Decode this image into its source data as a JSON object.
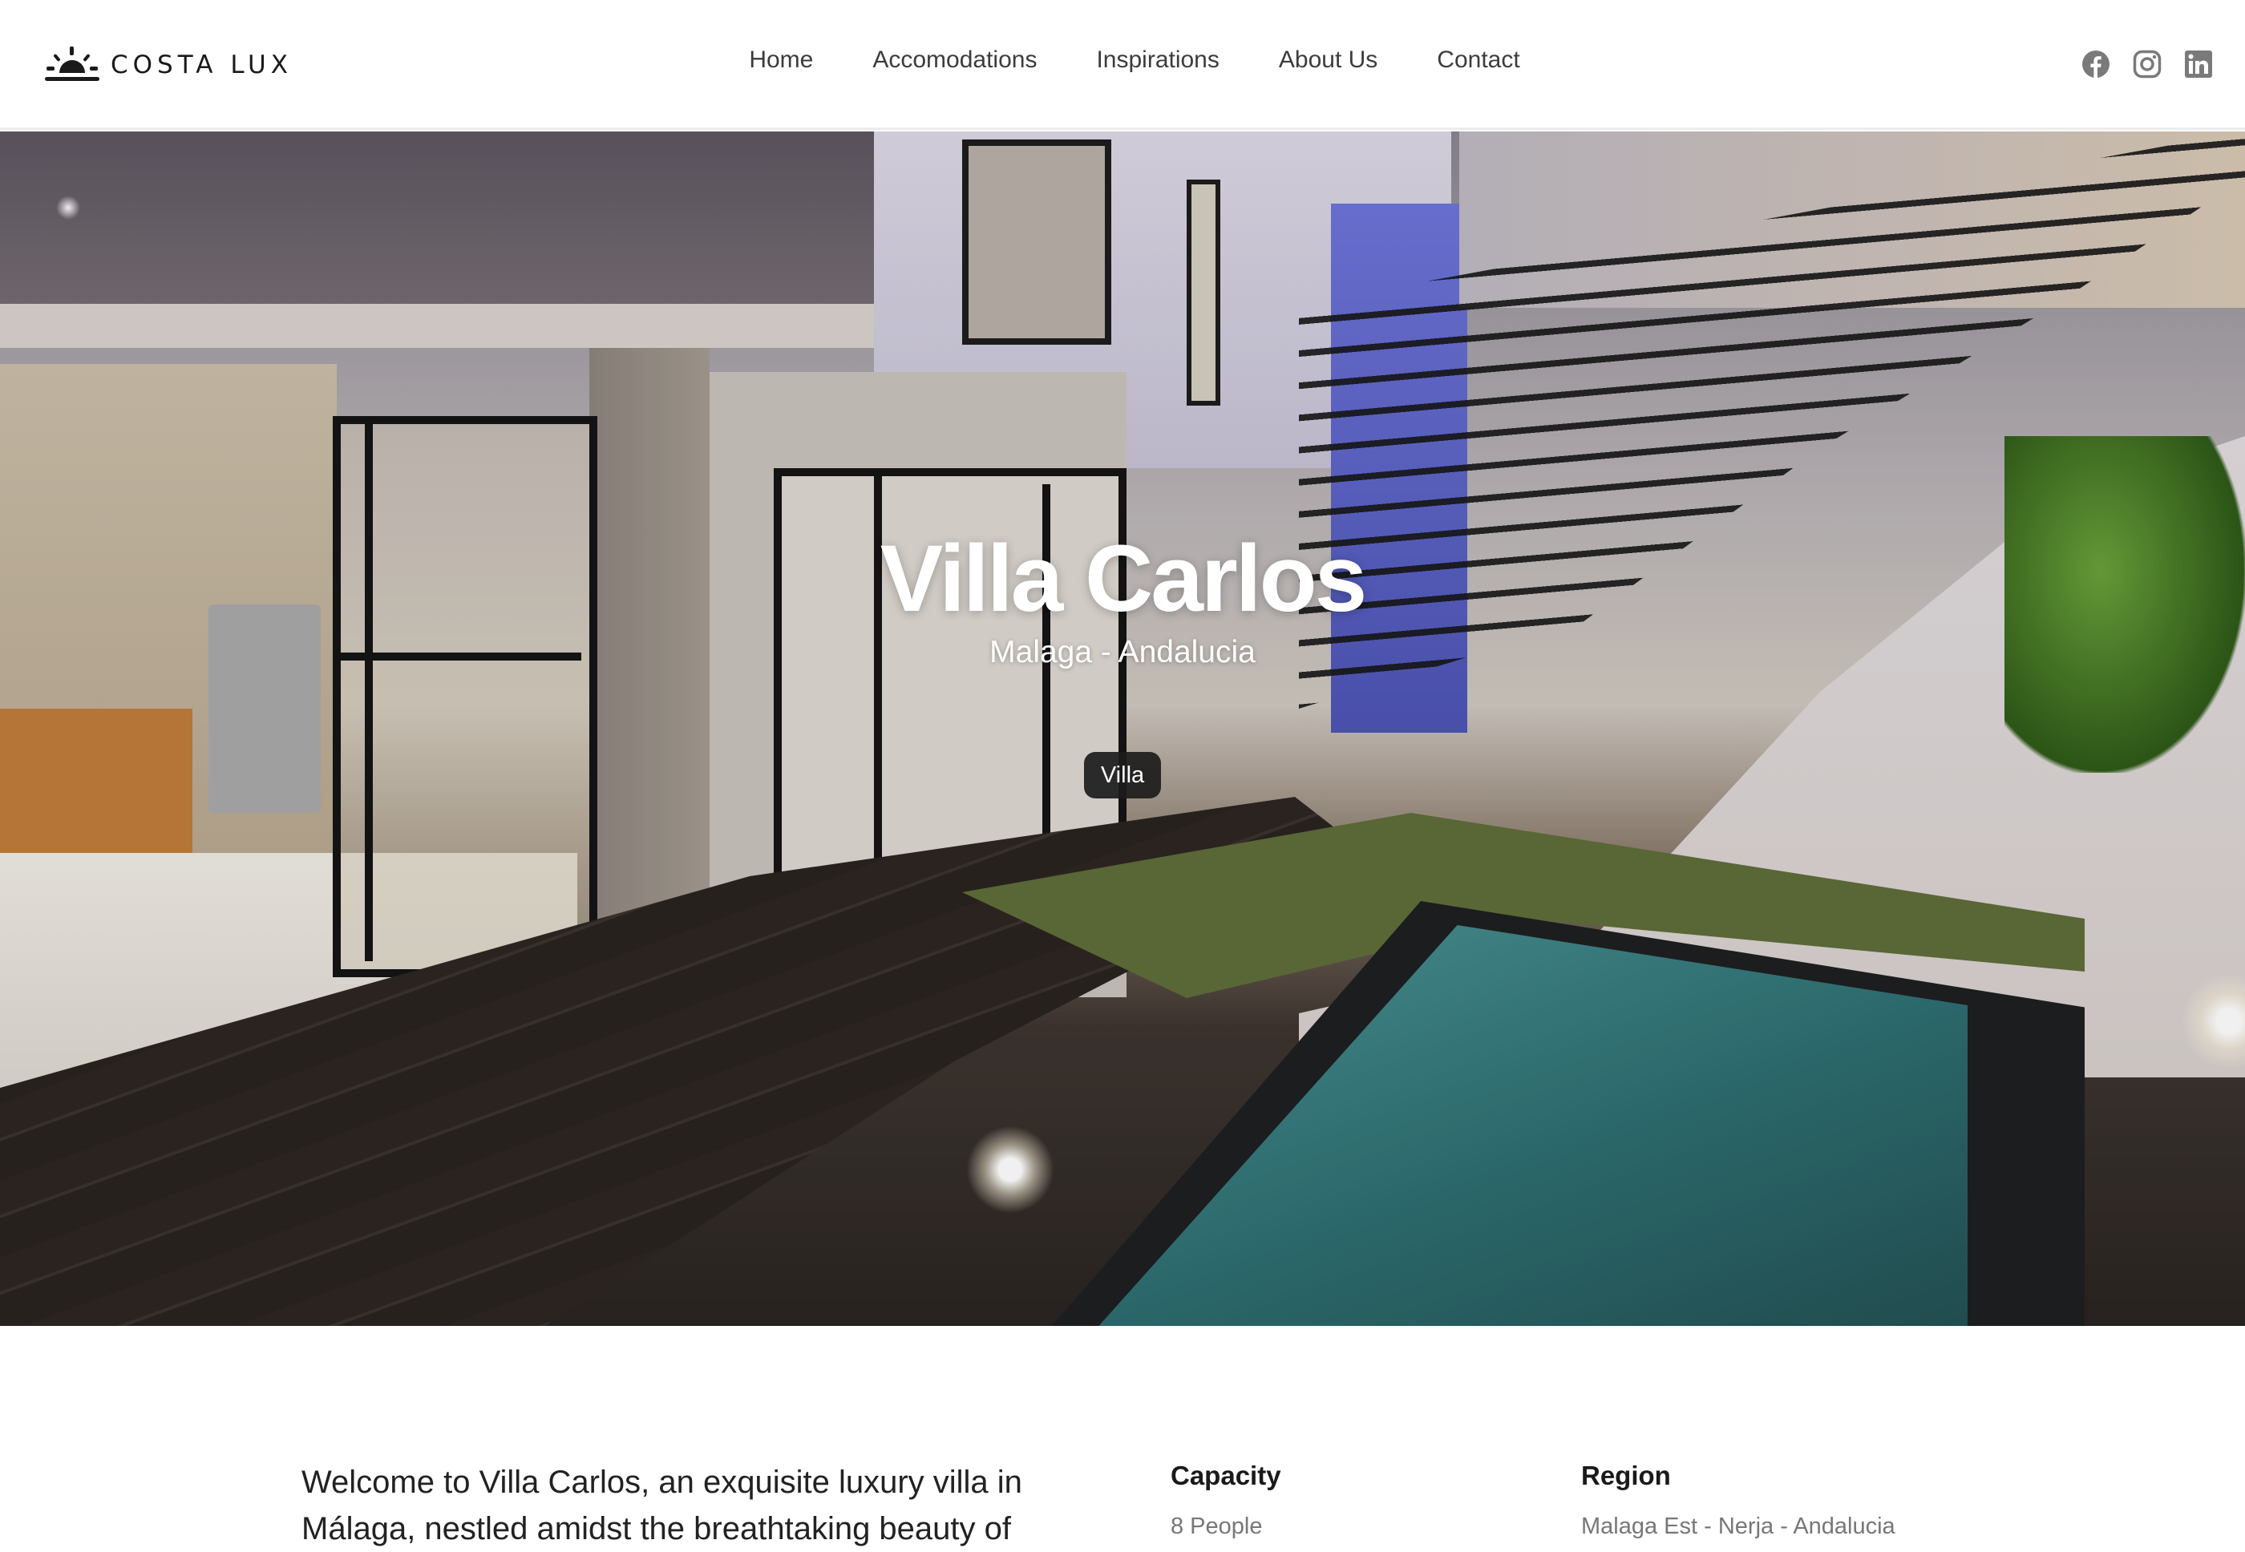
{
  "brand": {
    "name": "COSTA LUX",
    "logo_icon": "sunrise-icon"
  },
  "nav": {
    "items": [
      {
        "label": "Home"
      },
      {
        "label": "Accomodations"
      },
      {
        "label": "Inspirations"
      },
      {
        "label": "About Us"
      },
      {
        "label": "Contact"
      }
    ]
  },
  "social": [
    {
      "name": "facebook-icon"
    },
    {
      "name": "instagram-icon"
    },
    {
      "name": "linkedin-icon"
    }
  ],
  "hero": {
    "title": "Villa Carlos",
    "subtitle": "Malaga - Andalucia",
    "badge": "Villa"
  },
  "details": {
    "intro_line1": "Welcome to Villa Carlos, an exquisite luxury villa in",
    "intro_line2": "Málaga, nestled amidst the breathtaking beauty of",
    "capacity": {
      "label": "Capacity",
      "value": "8 People"
    },
    "region": {
      "label": "Region",
      "value": "Malaga Est - Nerja - Andalucia"
    }
  },
  "colors": {
    "text": "#222222",
    "nav": "#3c3c3c",
    "muted": "#777777",
    "badge_bg": "#1c1c1c",
    "icon": "#7a7a7a"
  }
}
